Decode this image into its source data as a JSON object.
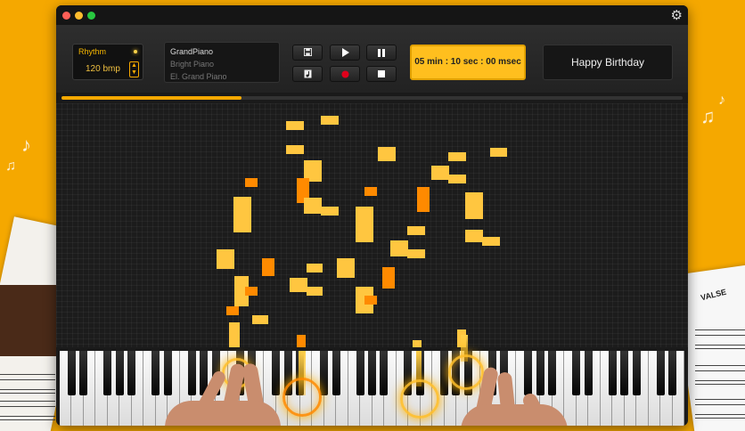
{
  "window": {
    "controls": [
      "close",
      "minimize",
      "zoom"
    ],
    "control_colors": [
      "#ff5f57",
      "#febc2e",
      "#28c840"
    ],
    "settings_icon": "gear-icon"
  },
  "rhythm": {
    "label": "Rhythm",
    "value": "120 bmp",
    "stepper_icon": "chevron-up-down-icon"
  },
  "instruments": {
    "items": [
      "GrandPiano",
      "Bright Piano",
      "El. Grand Piano"
    ],
    "selected": "GrandPiano"
  },
  "transport": {
    "save_icon": "save-icon",
    "play_icon": "play-icon",
    "pause_icon": "pause-icon",
    "open_icon": "music-file-icon",
    "record_icon": "record-icon",
    "stop_icon": "stop-icon"
  },
  "timer": "05 min : 10 sec : 00 msec",
  "song_title": "Happy Birthday",
  "progress": 0.29,
  "colors": {
    "accent": "#f5a800",
    "note": "#ffc640",
    "note_active": "#ff8a00",
    "record": "#e0001b",
    "background": "#f5a800"
  },
  "decorations": {
    "sheet_label": "VALSE"
  }
}
